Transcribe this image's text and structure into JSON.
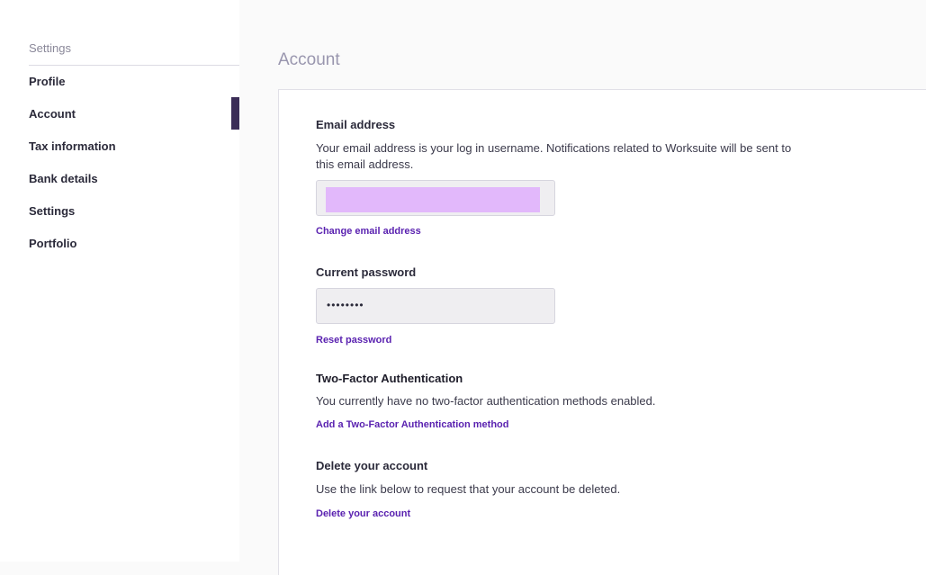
{
  "sidebar": {
    "heading": "Settings",
    "items": [
      {
        "label": "Profile"
      },
      {
        "label": "Account"
      },
      {
        "label": "Tax information"
      },
      {
        "label": "Bank details"
      },
      {
        "label": "Settings"
      },
      {
        "label": "Portfolio"
      }
    ],
    "active_index": 1
  },
  "main": {
    "title": "Account",
    "email": {
      "label": "Email address",
      "description": "Your email address is your log in username. Notifications related to Worksuite will be sent to this email address.",
      "link": "Change email address"
    },
    "password": {
      "label": "Current password",
      "value": "••••••••",
      "link": "Reset password"
    },
    "two_factor": {
      "label": "Two-Factor Authentication",
      "description": "You currently have no two-factor authentication methods enabled.",
      "link": "Add a Two-Factor Authentication method"
    },
    "delete": {
      "label": "Delete your account",
      "description": "Use the link below to request that your account be deleted.",
      "link": "Delete your account"
    }
  },
  "colors": {
    "accent": "#5a22b0",
    "active_bar": "#3b2d57",
    "redaction": "#e2b8fb"
  }
}
